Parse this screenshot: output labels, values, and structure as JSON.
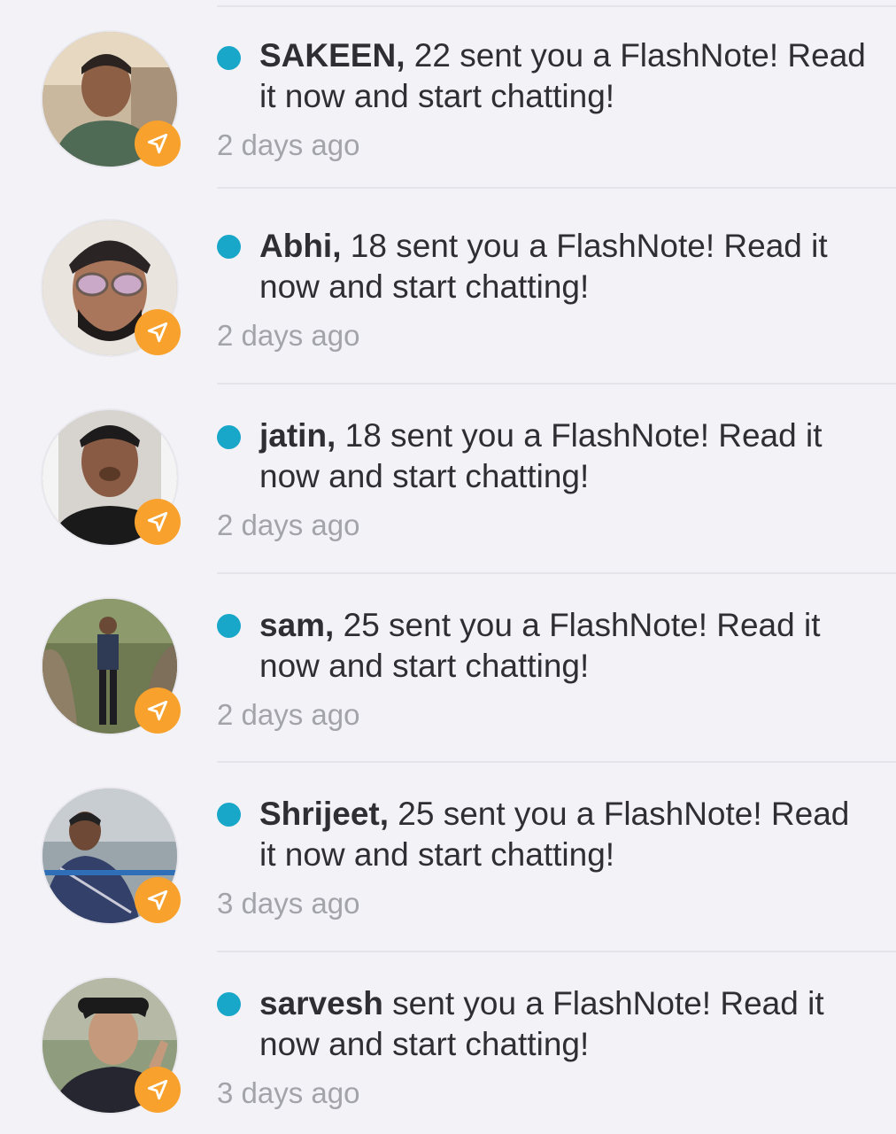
{
  "notifications": [
    {
      "name": "SAKEEN,",
      "text": " 22 sent you a FlashNote! Read it now and start chatting!",
      "time": "2 days ago"
    },
    {
      "name": "Abhi,",
      "text": " 18 sent you a FlashNote! Read it now and start chatting!",
      "time": "2 days ago"
    },
    {
      "name": "jatin,",
      "text": " 18 sent you a FlashNote! Read it now and start chatting!",
      "time": "2 days ago"
    },
    {
      "name": "sam,",
      "text": " 25 sent you a FlashNote! Read it now and start chatting!",
      "time": "2 days ago"
    },
    {
      "name": "Shrijeet,",
      "text": " 25 sent you a FlashNote! Read it now and start chatting!",
      "time": "3 days ago"
    },
    {
      "name": "sarvesh",
      "text": " sent you a FlashNote! Read it now and start chatting!",
      "time": "3 days ago"
    }
  ],
  "colors": {
    "unread_dot": "#18a7c8",
    "badge": "#f9a12d",
    "background": "#f3f3f7"
  },
  "icons": {
    "badge": "send-arrow-icon",
    "unread": "unread-dot-icon"
  }
}
